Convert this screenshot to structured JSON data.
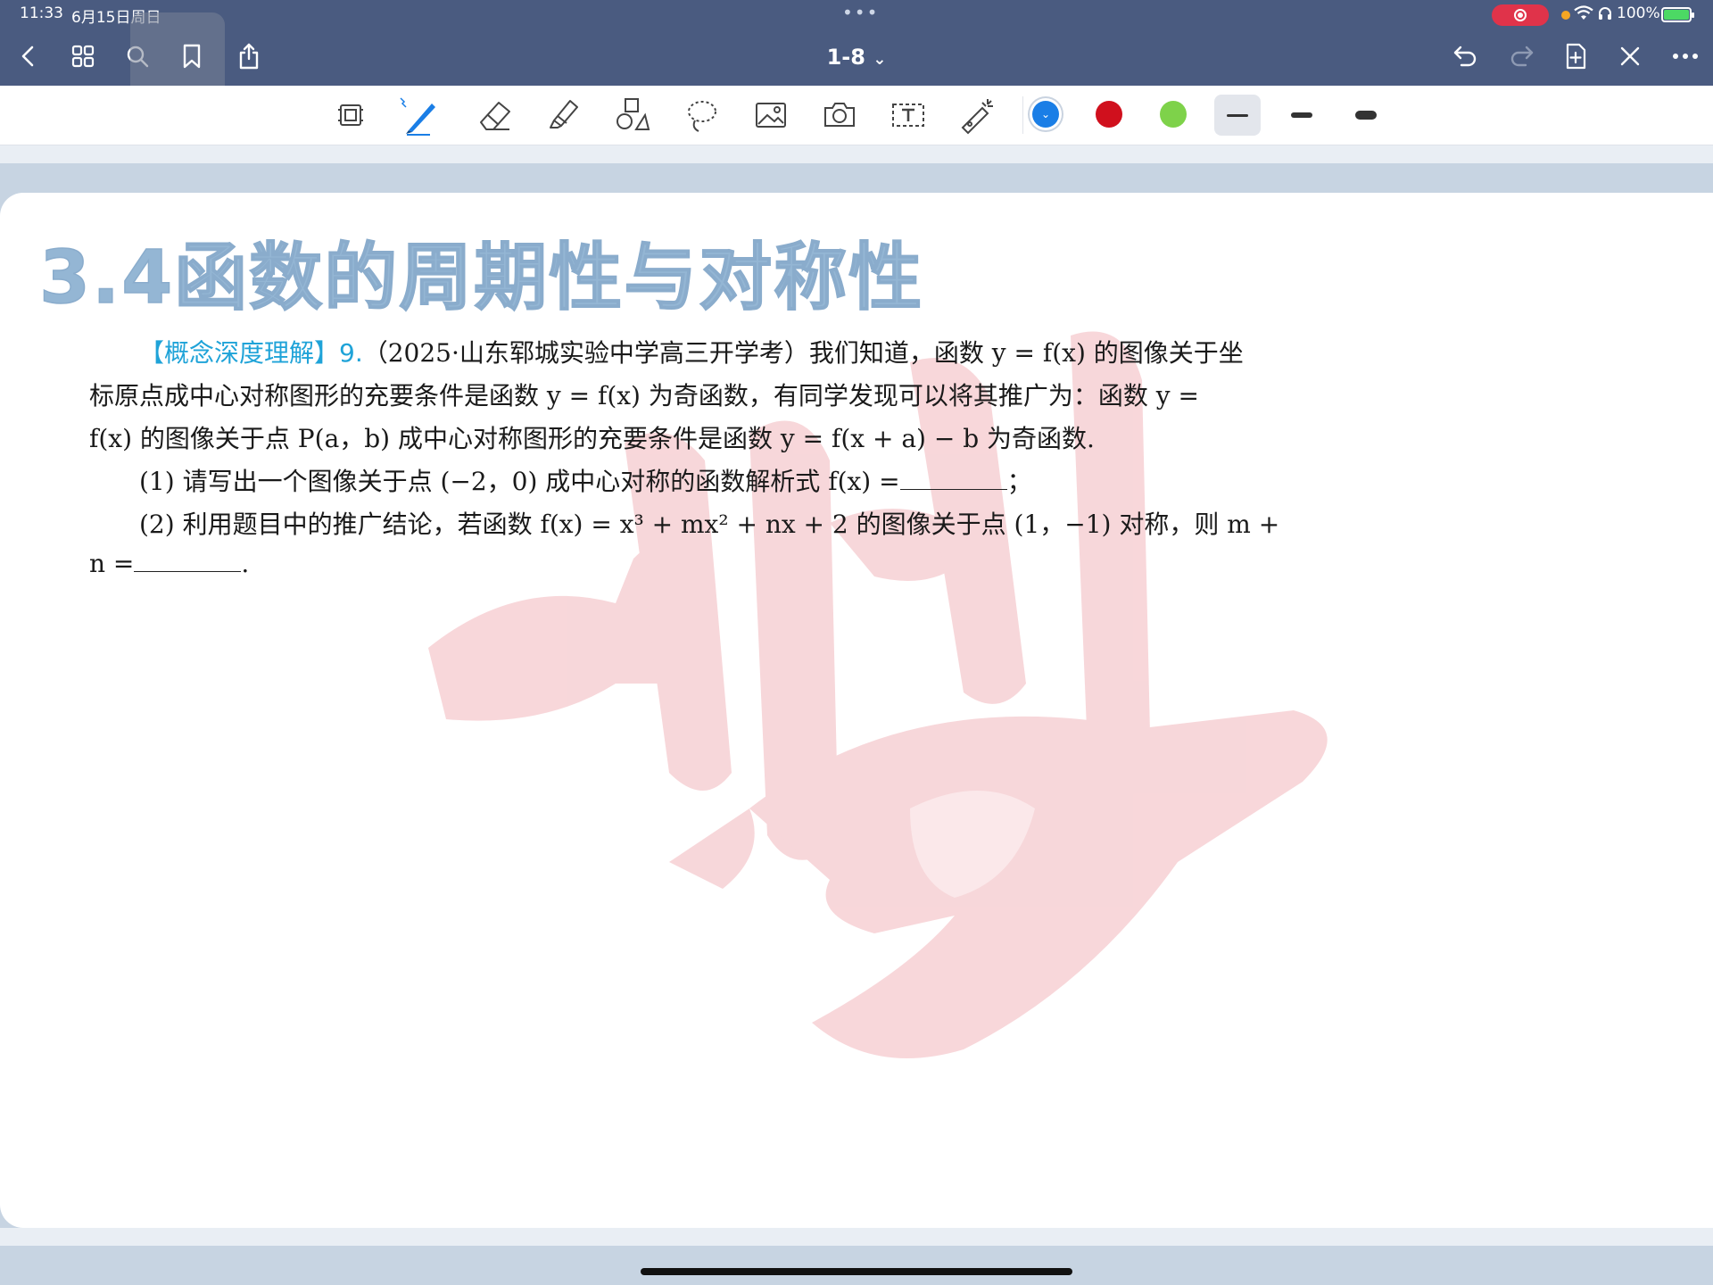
{
  "status": {
    "time": "11:33",
    "date": "6月15日周日",
    "battery": "100%"
  },
  "nav": {
    "title": "1-8",
    "title_chevron": "⌄"
  },
  "toolbar": {
    "tools": [
      "page-layout-icon",
      "pen-icon",
      "eraser-icon",
      "highlighter-icon",
      "shapes-icon",
      "lasso-icon",
      "image-icon",
      "camera-icon",
      "text-icon",
      "laser-pointer-icon"
    ],
    "colors": [
      "#1a7ee6",
      "#d0101d",
      "#7ed24a"
    ],
    "selected_color": "#1a7ee6",
    "selected_stroke": 0
  },
  "document": {
    "title": "3.4函数的周期性与对称性",
    "lines": [
      {
        "parts": [
          {
            "text": "【概念深度理解】9.",
            "style": "tag"
          },
          {
            "text": "（2025·山东郓城实验中学高三开学考）我们知道，函数 y = f(x) 的图像关于坐"
          }
        ]
      },
      {
        "parts": [
          {
            "text": "标原点成中心对称图形的充要条件是函数 y = f(x) 为奇函数，有同学发现可以将其推广为：函数 y ="
          }
        ]
      },
      {
        "parts": [
          {
            "text": "f(x) 的图像关于点 P(a，b) 成中心对称图形的充要条件是函数 y = f(x + a) − b 为奇函数."
          }
        ]
      },
      {
        "parts": [
          {
            "text": "(1) 请写出一个图像关于点 (−2，0) 成中心对称的函数解析式 f(x) ="
          },
          {
            "blank": 120
          },
          {
            "text": "；"
          }
        ]
      },
      {
        "parts": [
          {
            "text": "(2) 利用题目中的推广结论，若函数 f(x) = x³ + mx² + nx + 2 的图像关于点 (1，−1) 对称，则 m +"
          }
        ]
      },
      {
        "parts": [
          {
            "text": "n ="
          },
          {
            "blank": 120
          },
          {
            "text": "."
          }
        ]
      }
    ]
  }
}
